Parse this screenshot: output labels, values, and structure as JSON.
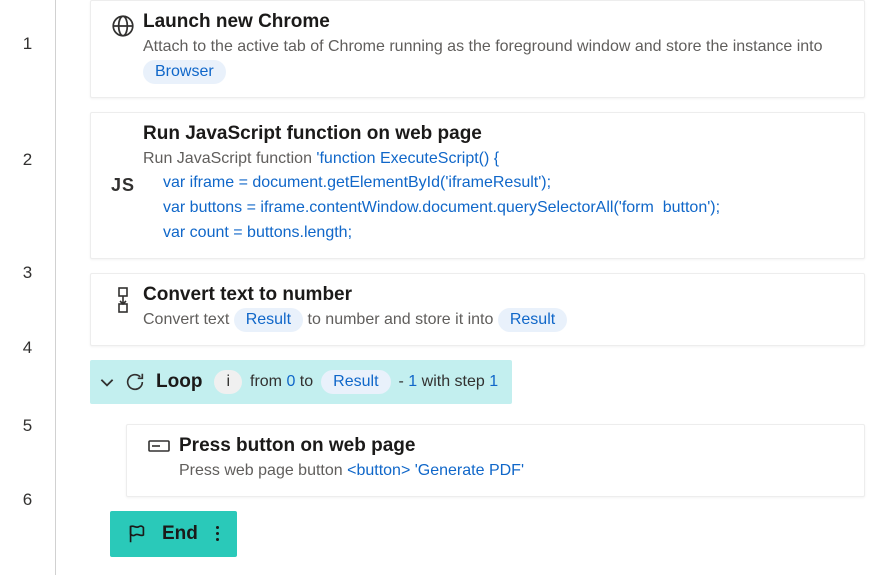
{
  "lines": {
    "l1": "1",
    "l2": "2",
    "l3": "3",
    "l4": "4",
    "l5": "5",
    "l6": "6"
  },
  "step1": {
    "title": "Launch new Chrome",
    "desc_a": "Attach to the active tab of Chrome running as the foreground window and store the instance into ",
    "browser_var": "Browser"
  },
  "step2": {
    "title": "Run JavaScript function on web page",
    "desc_a": "Run JavaScript function ",
    "code_l1": "'function ExecuteScript() {",
    "code_l2": "var iframe = document.getElementById('iframeResult');",
    "code_l3": "var buttons = iframe.contentWindow.document.querySelectorAll('form  button');",
    "code_l4": "var count = buttons.length;",
    "icon_label": "JS"
  },
  "step3": {
    "title": "Convert text to number",
    "desc_a": "Convert text ",
    "result_var": "Result",
    "desc_b": " to number and store it into ",
    "result_var2": "Result"
  },
  "loop": {
    "title": "Loop",
    "idx_var": "i",
    "from_label": "from ",
    "from_val": "0",
    "to_label": " to ",
    "result_var": "Result",
    "minus_label": " - ",
    "minus_val": "1",
    "step_label": " with step ",
    "step_val": "1"
  },
  "step5": {
    "title": "Press button on web page",
    "desc_a": "Press web page button ",
    "code": "<button> 'Generate PDF'"
  },
  "end": {
    "label": "End"
  }
}
